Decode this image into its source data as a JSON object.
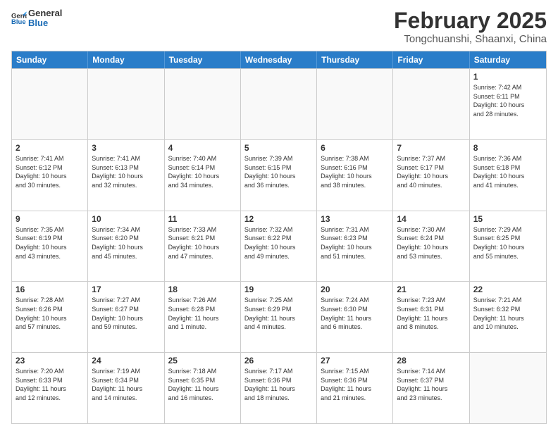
{
  "logo": {
    "line1": "General",
    "line2": "Blue"
  },
  "title": "February 2025",
  "subtitle": "Tongchuanshi, Shaanxi, China",
  "header_days": [
    "Sunday",
    "Monday",
    "Tuesday",
    "Wednesday",
    "Thursday",
    "Friday",
    "Saturday"
  ],
  "weeks": [
    [
      {
        "day": "",
        "info": "",
        "empty": true
      },
      {
        "day": "",
        "info": "",
        "empty": true
      },
      {
        "day": "",
        "info": "",
        "empty": true
      },
      {
        "day": "",
        "info": "",
        "empty": true
      },
      {
        "day": "",
        "info": "",
        "empty": true
      },
      {
        "day": "",
        "info": "",
        "empty": true
      },
      {
        "day": "1",
        "info": "Sunrise: 7:42 AM\nSunset: 6:11 PM\nDaylight: 10 hours\nand 28 minutes.",
        "empty": false
      }
    ],
    [
      {
        "day": "2",
        "info": "Sunrise: 7:41 AM\nSunset: 6:12 PM\nDaylight: 10 hours\nand 30 minutes.",
        "empty": false
      },
      {
        "day": "3",
        "info": "Sunrise: 7:41 AM\nSunset: 6:13 PM\nDaylight: 10 hours\nand 32 minutes.",
        "empty": false
      },
      {
        "day": "4",
        "info": "Sunrise: 7:40 AM\nSunset: 6:14 PM\nDaylight: 10 hours\nand 34 minutes.",
        "empty": false
      },
      {
        "day": "5",
        "info": "Sunrise: 7:39 AM\nSunset: 6:15 PM\nDaylight: 10 hours\nand 36 minutes.",
        "empty": false
      },
      {
        "day": "6",
        "info": "Sunrise: 7:38 AM\nSunset: 6:16 PM\nDaylight: 10 hours\nand 38 minutes.",
        "empty": false
      },
      {
        "day": "7",
        "info": "Sunrise: 7:37 AM\nSunset: 6:17 PM\nDaylight: 10 hours\nand 40 minutes.",
        "empty": false
      },
      {
        "day": "8",
        "info": "Sunrise: 7:36 AM\nSunset: 6:18 PM\nDaylight: 10 hours\nand 41 minutes.",
        "empty": false
      }
    ],
    [
      {
        "day": "9",
        "info": "Sunrise: 7:35 AM\nSunset: 6:19 PM\nDaylight: 10 hours\nand 43 minutes.",
        "empty": false
      },
      {
        "day": "10",
        "info": "Sunrise: 7:34 AM\nSunset: 6:20 PM\nDaylight: 10 hours\nand 45 minutes.",
        "empty": false
      },
      {
        "day": "11",
        "info": "Sunrise: 7:33 AM\nSunset: 6:21 PM\nDaylight: 10 hours\nand 47 minutes.",
        "empty": false
      },
      {
        "day": "12",
        "info": "Sunrise: 7:32 AM\nSunset: 6:22 PM\nDaylight: 10 hours\nand 49 minutes.",
        "empty": false
      },
      {
        "day": "13",
        "info": "Sunrise: 7:31 AM\nSunset: 6:23 PM\nDaylight: 10 hours\nand 51 minutes.",
        "empty": false
      },
      {
        "day": "14",
        "info": "Sunrise: 7:30 AM\nSunset: 6:24 PM\nDaylight: 10 hours\nand 53 minutes.",
        "empty": false
      },
      {
        "day": "15",
        "info": "Sunrise: 7:29 AM\nSunset: 6:25 PM\nDaylight: 10 hours\nand 55 minutes.",
        "empty": false
      }
    ],
    [
      {
        "day": "16",
        "info": "Sunrise: 7:28 AM\nSunset: 6:26 PM\nDaylight: 10 hours\nand 57 minutes.",
        "empty": false
      },
      {
        "day": "17",
        "info": "Sunrise: 7:27 AM\nSunset: 6:27 PM\nDaylight: 10 hours\nand 59 minutes.",
        "empty": false
      },
      {
        "day": "18",
        "info": "Sunrise: 7:26 AM\nSunset: 6:28 PM\nDaylight: 11 hours\nand 1 minute.",
        "empty": false
      },
      {
        "day": "19",
        "info": "Sunrise: 7:25 AM\nSunset: 6:29 PM\nDaylight: 11 hours\nand 4 minutes.",
        "empty": false
      },
      {
        "day": "20",
        "info": "Sunrise: 7:24 AM\nSunset: 6:30 PM\nDaylight: 11 hours\nand 6 minutes.",
        "empty": false
      },
      {
        "day": "21",
        "info": "Sunrise: 7:23 AM\nSunset: 6:31 PM\nDaylight: 11 hours\nand 8 minutes.",
        "empty": false
      },
      {
        "day": "22",
        "info": "Sunrise: 7:21 AM\nSunset: 6:32 PM\nDaylight: 11 hours\nand 10 minutes.",
        "empty": false
      }
    ],
    [
      {
        "day": "23",
        "info": "Sunrise: 7:20 AM\nSunset: 6:33 PM\nDaylight: 11 hours\nand 12 minutes.",
        "empty": false
      },
      {
        "day": "24",
        "info": "Sunrise: 7:19 AM\nSunset: 6:34 PM\nDaylight: 11 hours\nand 14 minutes.",
        "empty": false
      },
      {
        "day": "25",
        "info": "Sunrise: 7:18 AM\nSunset: 6:35 PM\nDaylight: 11 hours\nand 16 minutes.",
        "empty": false
      },
      {
        "day": "26",
        "info": "Sunrise: 7:17 AM\nSunset: 6:36 PM\nDaylight: 11 hours\nand 18 minutes.",
        "empty": false
      },
      {
        "day": "27",
        "info": "Sunrise: 7:15 AM\nSunset: 6:36 PM\nDaylight: 11 hours\nand 21 minutes.",
        "empty": false
      },
      {
        "day": "28",
        "info": "Sunrise: 7:14 AM\nSunset: 6:37 PM\nDaylight: 11 hours\nand 23 minutes.",
        "empty": false
      },
      {
        "day": "",
        "info": "",
        "empty": true
      }
    ]
  ]
}
